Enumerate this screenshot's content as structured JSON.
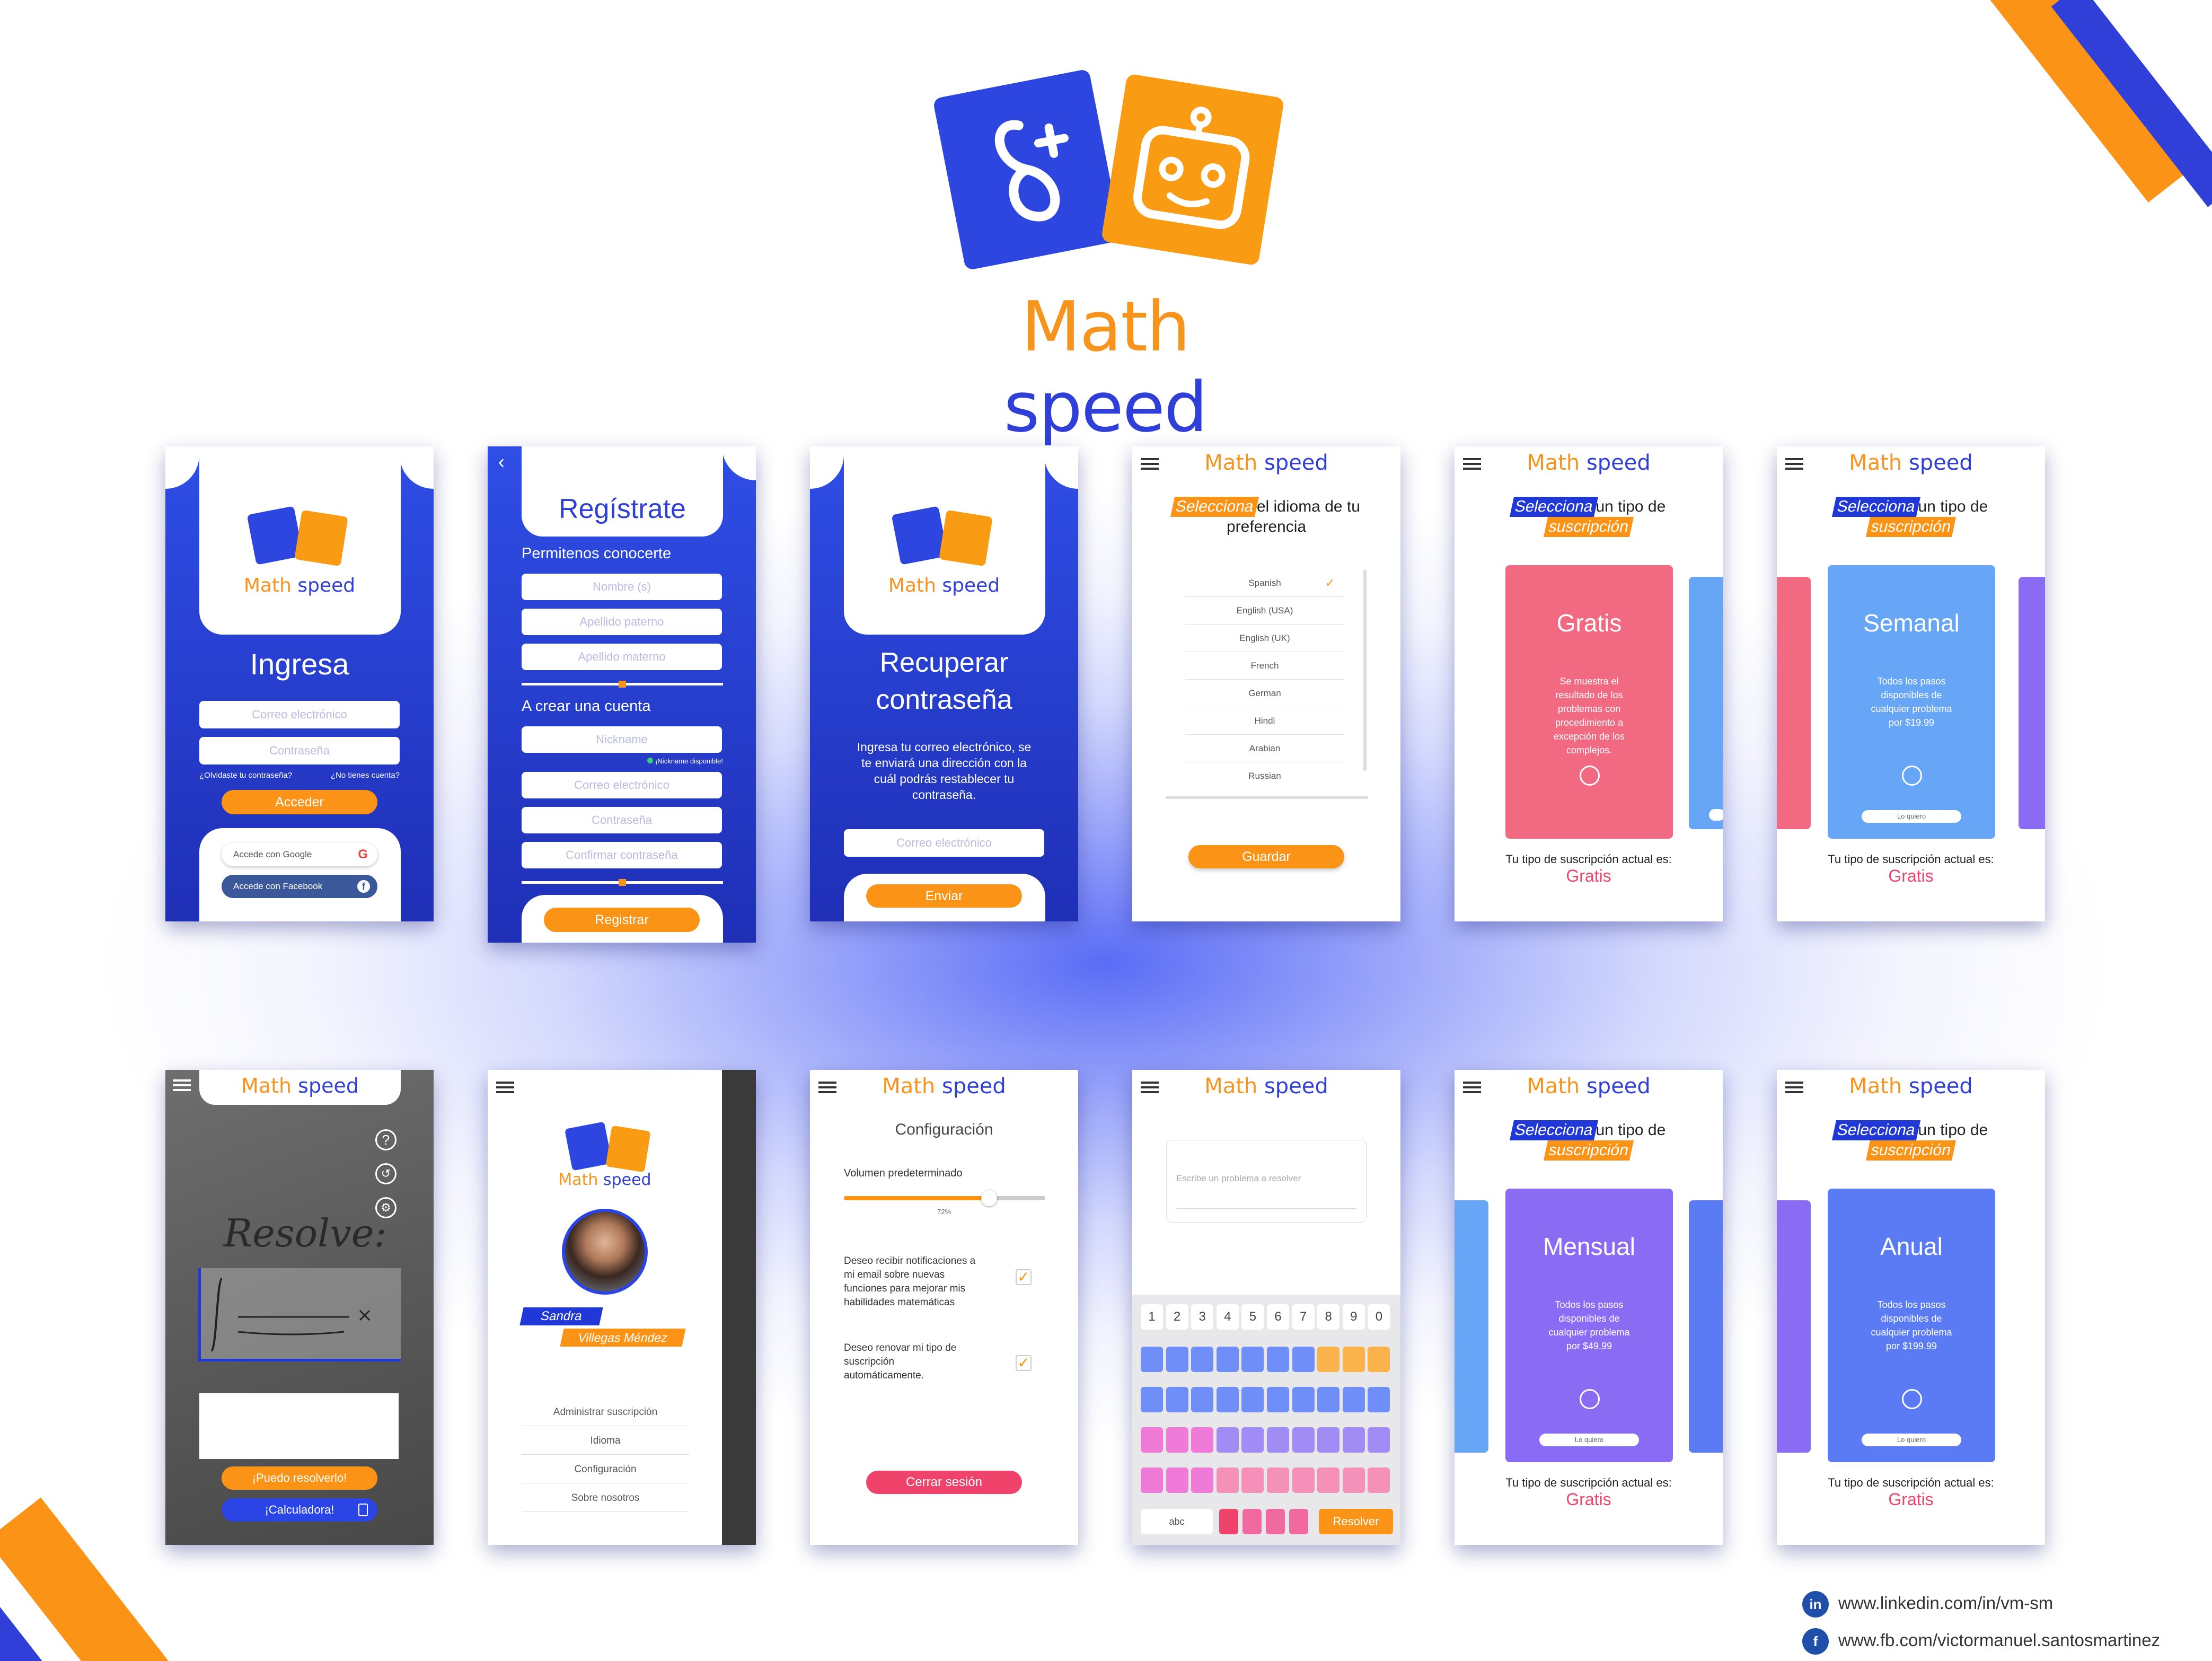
{
  "brand": {
    "part1": "Math",
    "part2": "speed"
  },
  "colors": {
    "blue": "#2f3fd8",
    "orange": "#f7941d",
    "pink": "#f0436b"
  },
  "login": {
    "title": "Ingresa",
    "email_placeholder": "Correo electrónico",
    "password_placeholder": "Contraseña",
    "forgot": "¿Olvidaste tu contraseña?",
    "no_account": "¿No tienes cuenta?",
    "submit": "Acceder",
    "google": "Accede con Google",
    "facebook": "Accede con Facebook"
  },
  "register": {
    "title": "Regístrate",
    "section1": "Permitenos conocerte",
    "name": "Nombre (s)",
    "last1": "Apellido paterno",
    "last2": "Apellido materno",
    "section2": "A crear una cuenta",
    "nickname": "Nickname",
    "nick_ok": "¡Nickname disponible!",
    "email": "Correo electrónico",
    "password": "Contraseña",
    "confirm": "Confirmar contraseña",
    "submit": "Registrar"
  },
  "recover": {
    "title_l1": "Recuperar",
    "title_l2": "contraseña",
    "body": [
      "Ingresa tu correo electrónico, se",
      "te enviará una dirección con la",
      "cuál podrás restablecer tu",
      "contraseña."
    ],
    "email": "Correo electrónico",
    "submit": "Enviar"
  },
  "language": {
    "highlight": "Selecciona",
    "rest": "el idioma de tu",
    "line2": "preferencia",
    "options": [
      "Spanish",
      "English (USA)",
      "English (UK)",
      "French",
      "German",
      "Hindi",
      "Arabian",
      "Russian"
    ],
    "save": "Guardar"
  },
  "subs": {
    "highlight": "Selecciona",
    "rest": "un tipo de",
    "line2": "suscripción",
    "current_label": "Tu tipo de suscripción actual es:",
    "current_value": "Gratis",
    "cta": "Lo quiero"
  },
  "plans": {
    "free": {
      "name": "Gratis",
      "desc": [
        "Se muestra el",
        "resultado de los",
        "problemas con",
        "procedimiento a",
        "excepción de los",
        "complejos."
      ]
    },
    "weekly": {
      "name": "Semanal",
      "desc": [
        "Todos los pasos",
        "disponibles de",
        "cualquier problema",
        "por $19.99"
      ]
    },
    "monthly": {
      "name": "Mensual",
      "desc": [
        "Todos los pasos",
        "disponibles de",
        "cualquier problema",
        "por $49.99"
      ]
    },
    "yearly": {
      "name": "Anual",
      "desc": [
        "Todos los pasos",
        "disponibles de",
        "cualquier problema",
        "por $199.99"
      ]
    }
  },
  "camera": {
    "handwriting": "Resolve:",
    "can_solve": "¡Puedo resolverlo!",
    "calculator": "¡Calculadora!"
  },
  "menu": {
    "first_name": "Sandra",
    "last_name": "Villegas Méndez",
    "items": [
      "Administrar suscripción",
      "Idioma",
      "Configuración",
      "Sobre nosotros"
    ]
  },
  "settings": {
    "title": "Configuración",
    "volume_label": "Volumen predeterminado",
    "volume_value": "72%",
    "volume_fraction": 0.72,
    "notify": [
      "Deseo recibir notificaciones a",
      "mi email sobre nuevas",
      "funciones para mejorar mis",
      "habilidades matemáticas"
    ],
    "renew": [
      "Deseo renovar mi tipo de",
      "suscripción",
      "automáticamente."
    ],
    "logout": "Cerrar sesión"
  },
  "keyboard": {
    "placeholder": "Escribe un problema a resolver",
    "digits": [
      "1",
      "2",
      "3",
      "4",
      "5",
      "6",
      "7",
      "8",
      "9",
      "0"
    ],
    "abc": "abc",
    "solve": "Resolver"
  },
  "contact": {
    "linkedin": "www.linkedin.com/in/vm-sm",
    "facebook": "www.fb.com/victormanuel.santosmartinez"
  }
}
